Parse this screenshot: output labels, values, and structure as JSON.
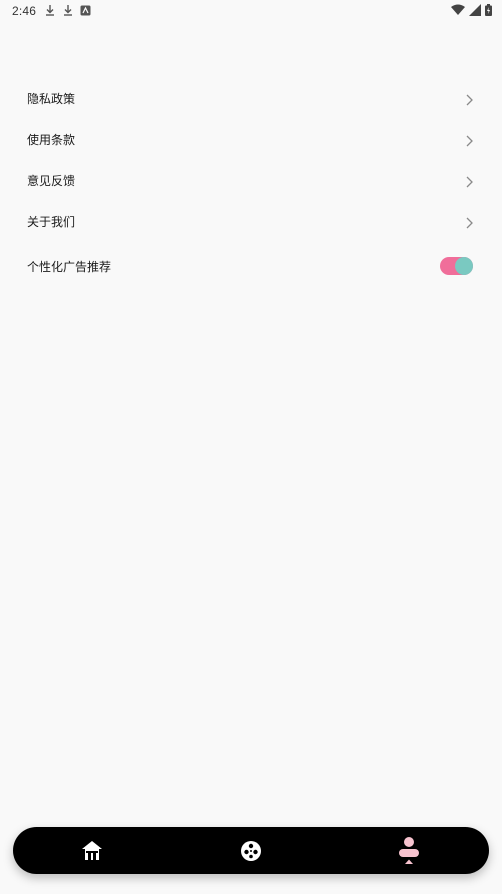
{
  "status_bar": {
    "time": "2:46",
    "left_icons": [
      "download-icon",
      "download-icon",
      "notification-app-icon"
    ],
    "right_icons": [
      "wifi-icon",
      "signal-icon",
      "battery-icon"
    ]
  },
  "menu": {
    "items": [
      {
        "label": "隐私政策",
        "icon": "chevron-right-icon"
      },
      {
        "label": "使用条款",
        "icon": "chevron-right-icon"
      },
      {
        "label": "意见反馈",
        "icon": "chevron-right-icon"
      },
      {
        "label": "关于我们",
        "icon": "chevron-right-icon"
      }
    ],
    "toggle_item": {
      "label": "个性化广告推荐",
      "enabled": true
    }
  },
  "bottom_nav": {
    "items": [
      {
        "icon": "home-icon",
        "active": false
      },
      {
        "icon": "film-reel-icon",
        "active": false
      },
      {
        "icon": "person-icon",
        "active": true
      }
    ]
  },
  "colors": {
    "background": "#f9f9f9",
    "toggle_track": "#f06e9a",
    "toggle_knob": "#7ac9c1",
    "nav_background": "#000000",
    "nav_active": "#f7c3cf",
    "nav_icon": "#ffffff"
  }
}
